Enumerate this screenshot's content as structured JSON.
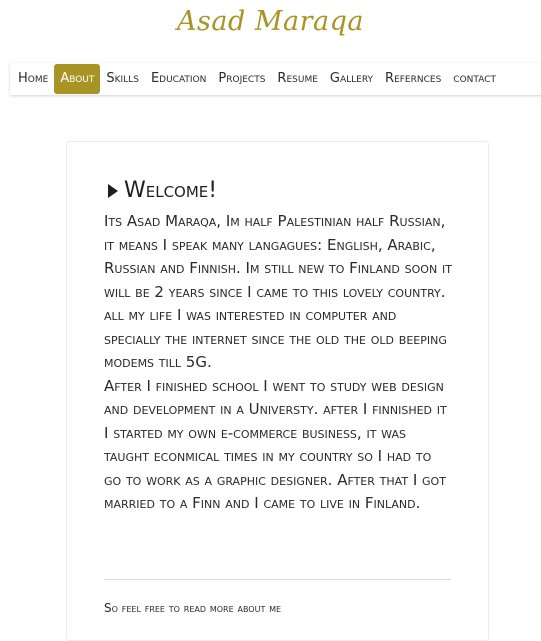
{
  "site": {
    "logo_text": "Asad Maraqa"
  },
  "nav": {
    "items": [
      {
        "label": "Home"
      },
      {
        "label": "About"
      },
      {
        "label": "Skills"
      },
      {
        "label": "Education"
      },
      {
        "label": "Projects"
      },
      {
        "label": "Resume"
      },
      {
        "label": "Gallery"
      },
      {
        "label": "Refernces"
      },
      {
        "label": "contact"
      }
    ],
    "active_index": 1,
    "accent_color": "#a89424"
  },
  "about": {
    "heading_icon": "caret-right-icon",
    "heading": "Welcome!",
    "paragraph_1": "Its Asad Maraqa, Im half Palestinian half Russian, it means I speak many langagues: English, Arabic, Russian and Finnish. Im still new to Finland soon it will be 2 years since I came to this lovely country. all my life I was interested in computer and specially the internet since the old the old beeping modems till 5G.",
    "paragraph_2": "After I finished school I went to study web design and development in a Universty. after I finnished it I started my own e-commerce business, it was taught econmical times in my country so I had to go to work as a graphic designer. After that I got married to a Finn and I came to live in Finland.",
    "more_text": "So feel free to read more about me"
  }
}
